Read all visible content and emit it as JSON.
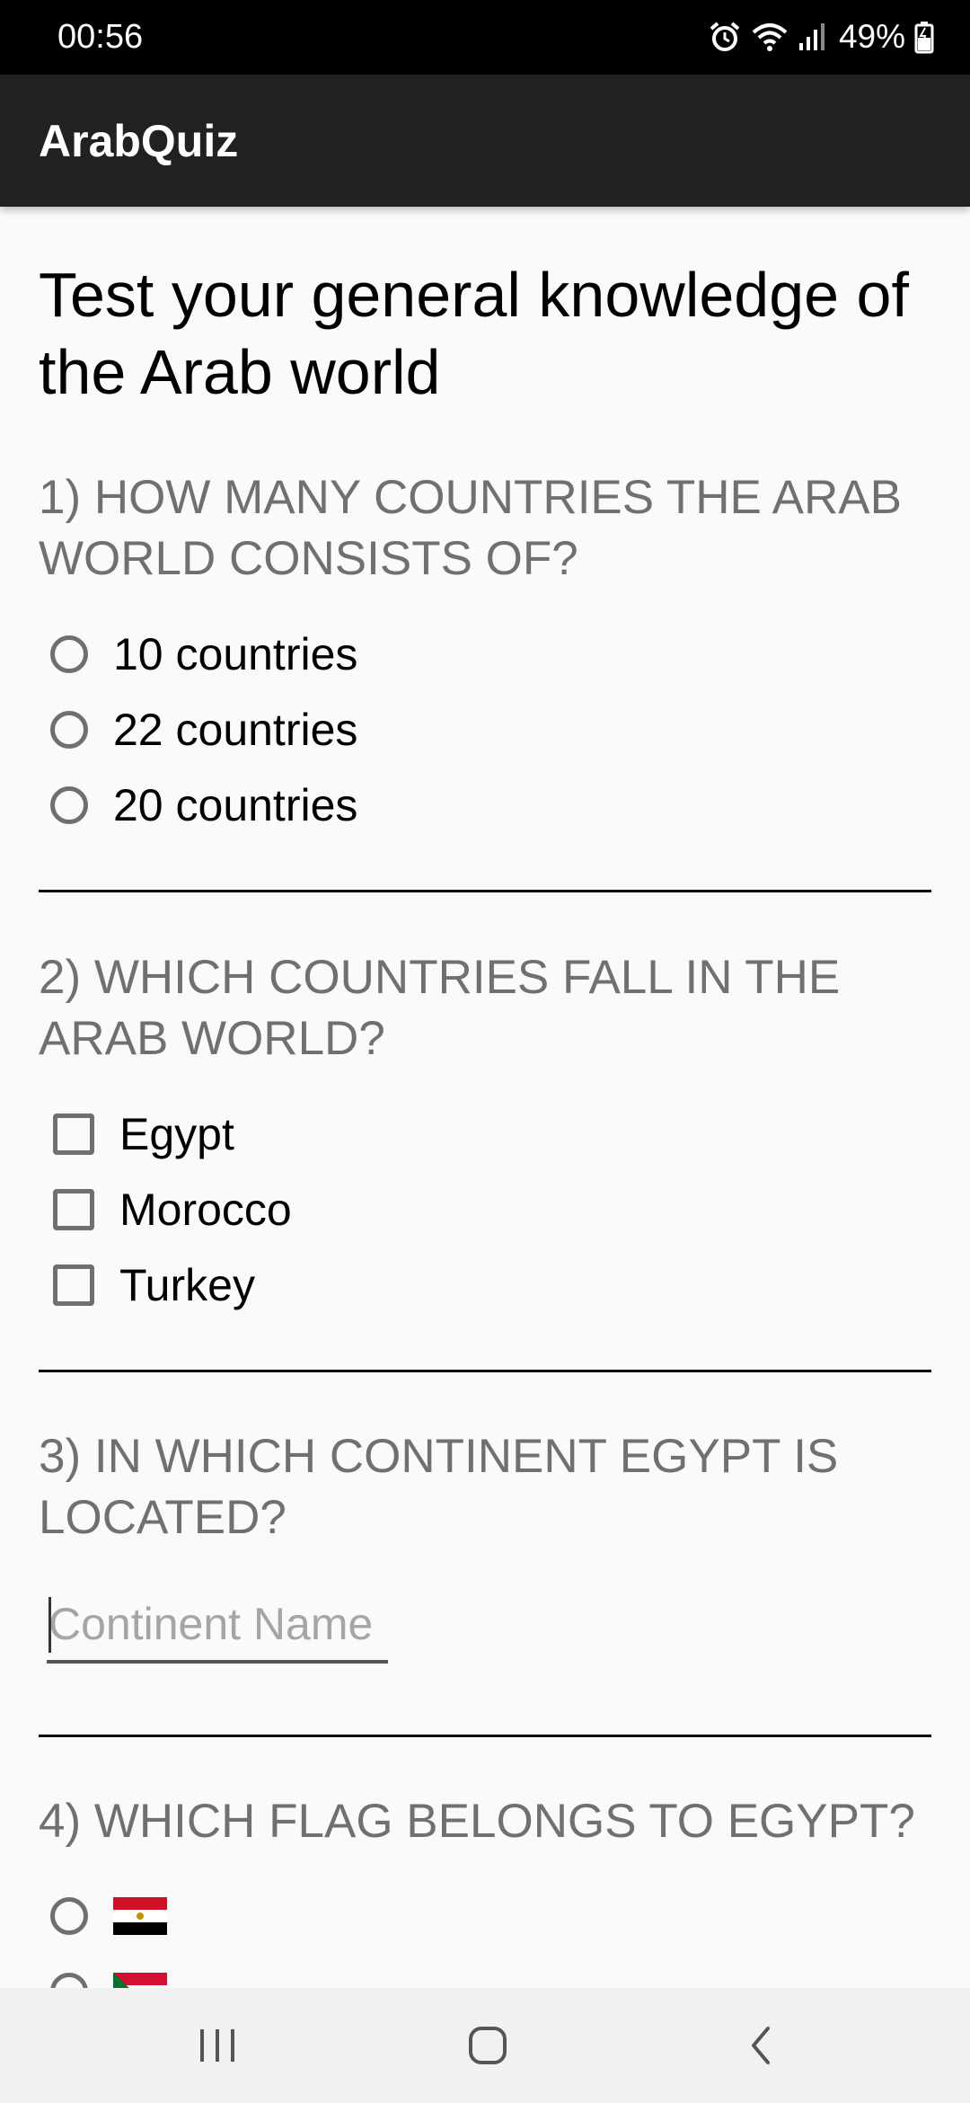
{
  "status_bar": {
    "time": "00:56",
    "battery": "49%",
    "icons": [
      "alarm-icon",
      "wifi-icon",
      "signal-icon",
      "battery-icon"
    ]
  },
  "app_bar": {
    "title": "ArabQuiz"
  },
  "quiz": {
    "title": "Test your general knowledge of the Arab world",
    "q1": {
      "question": "1) HOW MANY COUNTRIES THE ARAB WORLD CONSISTS OF?",
      "options": [
        "10 countries",
        "22 countries",
        "20 countries"
      ]
    },
    "q2": {
      "question": "2) WHICH COUNTRIES FALL IN THE ARAB WORLD?",
      "options": [
        "Egypt",
        "Morocco",
        "Turkey"
      ]
    },
    "q3": {
      "question": "3) IN WHICH CONTINENT EGYPT IS LOCATED?",
      "placeholder": "Continent Name",
      "value": ""
    },
    "q4": {
      "question": "4) WHICH FLAG BELONGS TO EGYPT?",
      "options": [
        "egypt-flag-icon",
        "sudan-flag-icon"
      ]
    }
  },
  "nav_bar": {
    "icons": [
      "recent-apps-icon",
      "home-icon",
      "back-icon"
    ]
  },
  "colors": {
    "status_bar": "#000000",
    "app_bar": "#212121",
    "background": "#fafafa",
    "question_text": "#707070",
    "placeholder_text": "#a5a5a5"
  }
}
